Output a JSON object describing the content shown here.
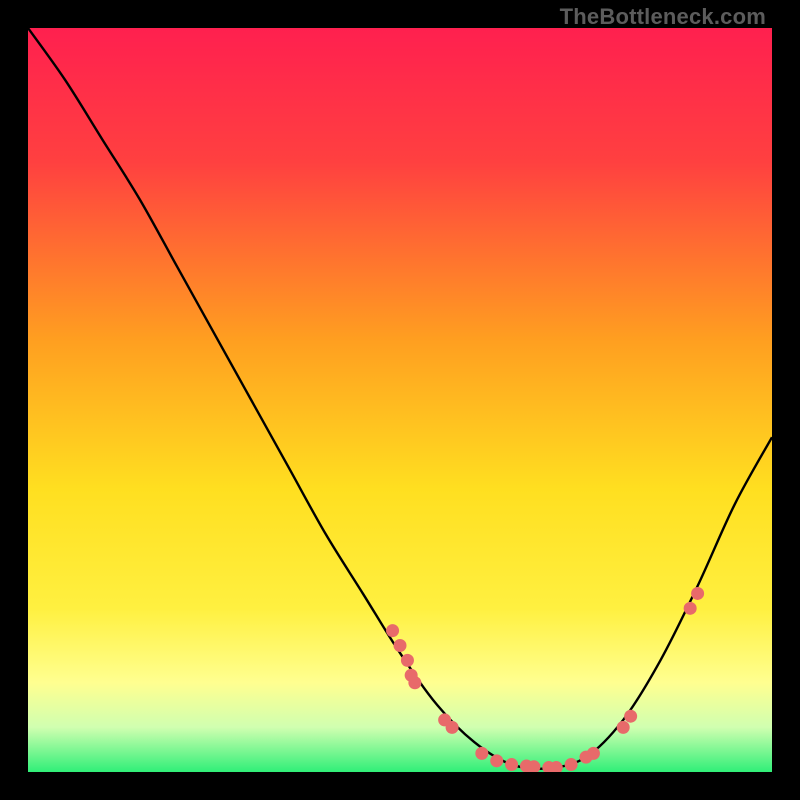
{
  "attribution": "TheBottleneck.com",
  "chart_data": {
    "type": "line",
    "title": "",
    "xlabel": "",
    "ylabel": "",
    "xlim": [
      0,
      100
    ],
    "ylim": [
      0,
      100
    ],
    "grid": false,
    "background_gradient": {
      "top": "#ff2050",
      "mid": "#ffdf20",
      "bottom1": "#ffff80",
      "bottom2": "#40ff80"
    },
    "curve": [
      {
        "x": 0,
        "y": 100
      },
      {
        "x": 5,
        "y": 93
      },
      {
        "x": 10,
        "y": 85
      },
      {
        "x": 15,
        "y": 77
      },
      {
        "x": 20,
        "y": 68
      },
      {
        "x": 25,
        "y": 59
      },
      {
        "x": 30,
        "y": 50
      },
      {
        "x": 35,
        "y": 41
      },
      {
        "x": 40,
        "y": 32
      },
      {
        "x": 45,
        "y": 24
      },
      {
        "x": 50,
        "y": 16
      },
      {
        "x": 55,
        "y": 9
      },
      {
        "x": 60,
        "y": 4
      },
      {
        "x": 65,
        "y": 1
      },
      {
        "x": 70,
        "y": 0.5
      },
      {
        "x": 75,
        "y": 2
      },
      {
        "x": 80,
        "y": 7
      },
      {
        "x": 85,
        "y": 15
      },
      {
        "x": 90,
        "y": 25
      },
      {
        "x": 95,
        "y": 36
      },
      {
        "x": 100,
        "y": 45
      }
    ],
    "markers": [
      {
        "x": 49,
        "y": 19
      },
      {
        "x": 50,
        "y": 17
      },
      {
        "x": 51,
        "y": 15
      },
      {
        "x": 51.5,
        "y": 13
      },
      {
        "x": 52,
        "y": 12
      },
      {
        "x": 56,
        "y": 7
      },
      {
        "x": 57,
        "y": 6
      },
      {
        "x": 61,
        "y": 2.5
      },
      {
        "x": 63,
        "y": 1.5
      },
      {
        "x": 65,
        "y": 1
      },
      {
        "x": 67,
        "y": 0.8
      },
      {
        "x": 68,
        "y": 0.7
      },
      {
        "x": 70,
        "y": 0.6
      },
      {
        "x": 71,
        "y": 0.6
      },
      {
        "x": 73,
        "y": 1
      },
      {
        "x": 75,
        "y": 2
      },
      {
        "x": 76,
        "y": 2.5
      },
      {
        "x": 80,
        "y": 6
      },
      {
        "x": 81,
        "y": 7.5
      },
      {
        "x": 89,
        "y": 22
      },
      {
        "x": 90,
        "y": 24
      }
    ],
    "marker_color": "#e86a6a",
    "line_color": "#000000"
  }
}
